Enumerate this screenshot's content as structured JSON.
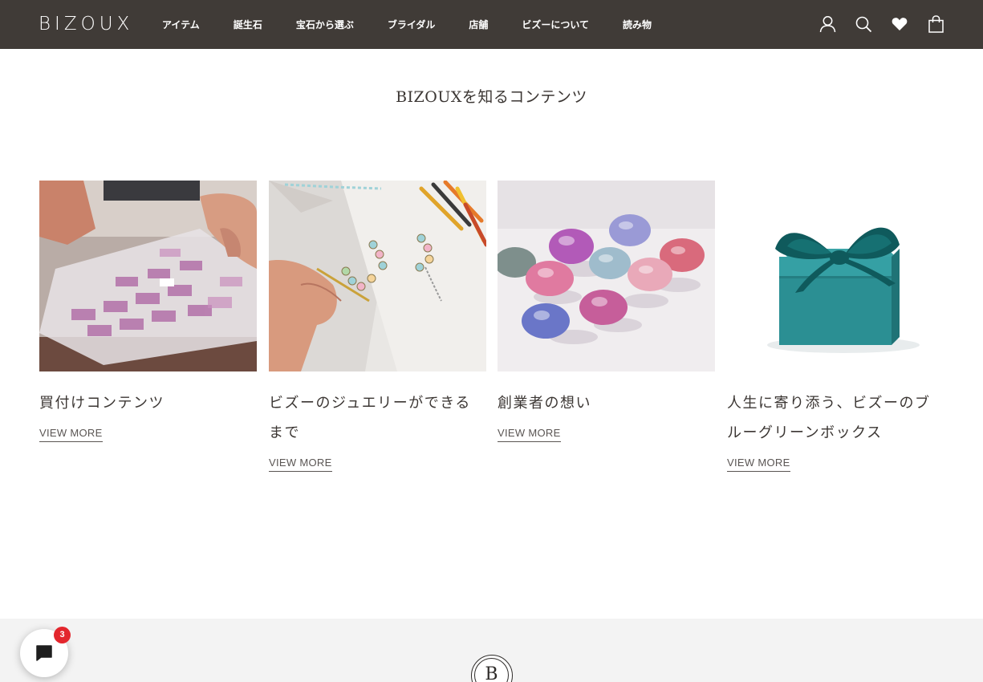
{
  "header": {
    "logo": "BIZOUX",
    "nav": [
      "アイテム",
      "誕生石",
      "宝石から選ぶ",
      "ブライダル",
      "店舗",
      "ビズーについて",
      "読み物"
    ],
    "icons": [
      "account-icon",
      "search-icon",
      "wishlist-heart-icon",
      "cart-bag-icon"
    ]
  },
  "section": {
    "title": "BIZOUXを知るコンテンツ",
    "cards": [
      {
        "title": "買付けコンテンツ",
        "link": "VIEW MORE",
        "image": "gemstone-tray-photo"
      },
      {
        "title": "ビズーのジュエリーができるまで",
        "link": "VIEW MORE",
        "image": "jewelry-sketch-photo"
      },
      {
        "title": "創業者の想い",
        "link": "VIEW MORE",
        "image": "loose-gemstones-photo"
      },
      {
        "title": "人生に寄り添う、ビズーのブルーグリーンボックス",
        "link": "VIEW MORE",
        "image": "blue-green-box-photo"
      }
    ]
  },
  "footer": {
    "logo_letter": "B"
  },
  "chat": {
    "badge": "3"
  },
  "colors": {
    "header_bg": "#403b37",
    "footer_bg": "#f3f3f3",
    "badge": "#e3262d",
    "box_teal": "#2b8f93"
  }
}
